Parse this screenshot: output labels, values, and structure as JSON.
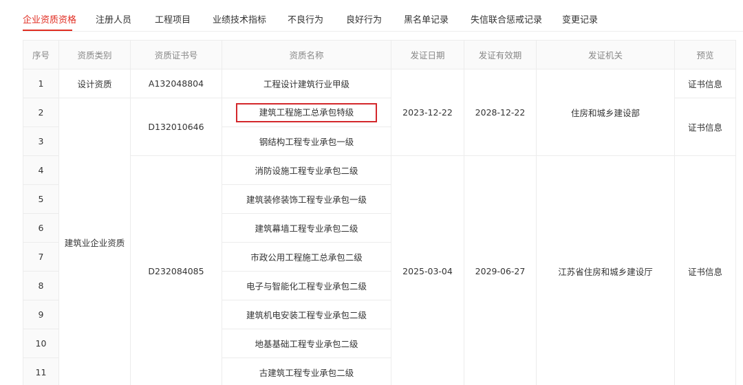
{
  "tabs": [
    {
      "label": "企业资质资格",
      "active": true
    },
    {
      "label": "注册人员"
    },
    {
      "label": "工程项目"
    },
    {
      "label": "业绩技术指标"
    },
    {
      "label": "不良行为"
    },
    {
      "label": "良好行为"
    },
    {
      "label": "黑名单记录"
    },
    {
      "label": "失信联合惩戒记录"
    },
    {
      "label": "变更记录"
    }
  ],
  "table": {
    "headers": [
      "序号",
      "资质类别",
      "资质证书号",
      "资质名称",
      "发证日期",
      "发证有效期",
      "发证机关",
      "预览"
    ],
    "categories": [
      "设计资质",
      "建筑业企业资质"
    ],
    "cert_nos": [
      "A132048804",
      "D132010646",
      "D232084085"
    ],
    "issue_dates": [
      "2023-12-22",
      "2025-03-04"
    ],
    "valid_until": [
      "2028-12-22",
      "2029-06-27"
    ],
    "authorities": [
      "住房和城乡建设部",
      "江苏省住房和城乡建设厅"
    ],
    "preview_link": "证书信息",
    "rows": [
      {
        "no": "1",
        "name": "工程设计建筑行业甲级"
      },
      {
        "no": "2",
        "name": "建筑工程施工总承包特级",
        "highlighted": true
      },
      {
        "no": "3",
        "name": "钢结构工程专业承包一级"
      },
      {
        "no": "4",
        "name": "消防设施工程专业承包二级"
      },
      {
        "no": "5",
        "name": "建筑装修装饰工程专业承包一级"
      },
      {
        "no": "6",
        "name": "建筑幕墙工程专业承包二级"
      },
      {
        "no": "7",
        "name": "市政公用工程施工总承包二级"
      },
      {
        "no": "8",
        "name": "电子与智能化工程专业承包二级"
      },
      {
        "no": "9",
        "name": "建筑机电安装工程专业承包二级"
      },
      {
        "no": "10",
        "name": "地基基础工程专业承包二级"
      },
      {
        "no": "11",
        "name": "古建筑工程专业承包二级"
      }
    ]
  },
  "colors": {
    "accent": "#e02b20",
    "highlight_border": "#d3262a",
    "header_text": "#888888",
    "border": "#ececec"
  }
}
